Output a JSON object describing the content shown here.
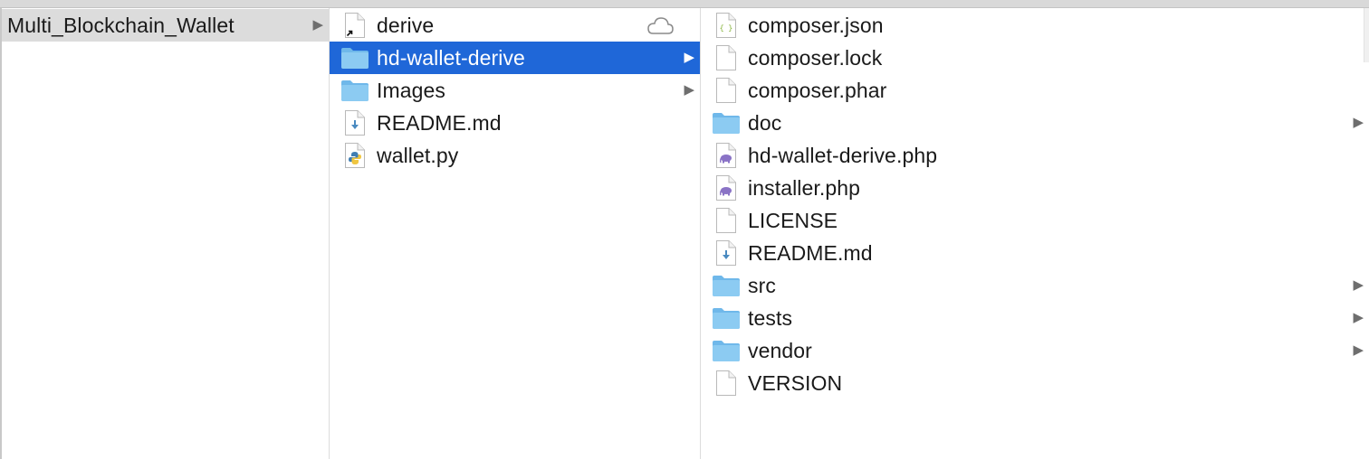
{
  "columns": [
    {
      "items": [
        {
          "label": "Multi_Blockchain_Wallet",
          "icon": "none",
          "state": "parent-open",
          "has_children": true
        }
      ]
    },
    {
      "items": [
        {
          "label": "derive",
          "icon": "alias-file-icon",
          "state": "normal",
          "has_children": false,
          "cloud": true
        },
        {
          "label": "hd-wallet-derive",
          "icon": "folder-icon",
          "state": "selected",
          "has_children": true
        },
        {
          "label": "Images",
          "icon": "folder-icon",
          "state": "normal",
          "has_children": true
        },
        {
          "label": "README.md",
          "icon": "markdown-file-icon",
          "state": "normal",
          "has_children": false
        },
        {
          "label": "wallet.py",
          "icon": "python-file-icon",
          "state": "normal",
          "has_children": false
        }
      ]
    },
    {
      "items": [
        {
          "label": "composer.json",
          "icon": "json-file-icon",
          "state": "normal",
          "has_children": false
        },
        {
          "label": "composer.lock",
          "icon": "blank-file-icon",
          "state": "normal",
          "has_children": false
        },
        {
          "label": "composer.phar",
          "icon": "blank-file-icon",
          "state": "normal",
          "has_children": false
        },
        {
          "label": "doc",
          "icon": "folder-icon",
          "state": "normal",
          "has_children": true
        },
        {
          "label": "hd-wallet-derive.php",
          "icon": "php-file-icon",
          "state": "normal",
          "has_children": false
        },
        {
          "label": "installer.php",
          "icon": "php-file-icon",
          "state": "normal",
          "has_children": false
        },
        {
          "label": "LICENSE",
          "icon": "blank-file-icon",
          "state": "normal",
          "has_children": false
        },
        {
          "label": "README.md",
          "icon": "markdown-file-icon",
          "state": "normal",
          "has_children": false
        },
        {
          "label": "src",
          "icon": "folder-icon",
          "state": "normal",
          "has_children": true
        },
        {
          "label": "tests",
          "icon": "folder-icon",
          "state": "normal",
          "has_children": true
        },
        {
          "label": "vendor",
          "icon": "folder-icon",
          "state": "normal",
          "has_children": true
        },
        {
          "label": "VERSION",
          "icon": "blank-file-icon",
          "state": "normal",
          "has_children": false
        }
      ]
    }
  ],
  "colors": {
    "selection": "#1f67d8",
    "parent_highlight": "#dcdcdc",
    "folder": "#8ccbf2",
    "text": "#1a1a1a"
  }
}
